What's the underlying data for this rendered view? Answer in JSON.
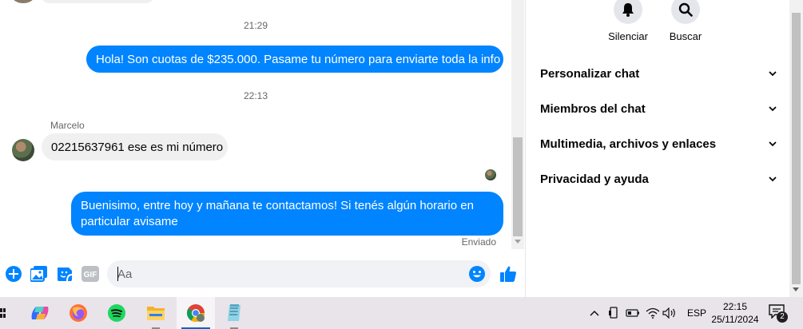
{
  "chat": {
    "timestamp_1": "21:29",
    "message_out_1": "Hola! Son cuotas de $235.000. Pasame tu número para enviarte toda la info",
    "timestamp_2": "22:13",
    "sender_name": "Marcelo",
    "message_in_1": "02215637961 ese es mi número",
    "message_out_2_line1": "Buenisimo, entre hoy y mañana te contactamos! Si tenés algún horario en",
    "message_out_2_line2": "particular avisame",
    "status": "Enviado"
  },
  "composer": {
    "placeholder": "Aa",
    "gif_label": "GIF"
  },
  "right_panel": {
    "mute_label": "Silenciar",
    "search_label": "Buscar",
    "sections": [
      {
        "label": "Personalizar chat"
      },
      {
        "label": "Miembros del chat"
      },
      {
        "label": "Multimedia, archivos y enlaces"
      },
      {
        "label": "Privacidad y ayuda"
      }
    ]
  },
  "taskbar": {
    "apps": [
      "copilot",
      "firefox",
      "spotify",
      "file-explorer",
      "chrome",
      "notepad"
    ],
    "language": "ESP",
    "time": "22:15",
    "date": "25/11/2024",
    "notification_count": "2"
  },
  "colors": {
    "accent": "#0084ff",
    "incoming_bubble": "#f0f0f0",
    "taskbar": "#e8e4ea"
  }
}
